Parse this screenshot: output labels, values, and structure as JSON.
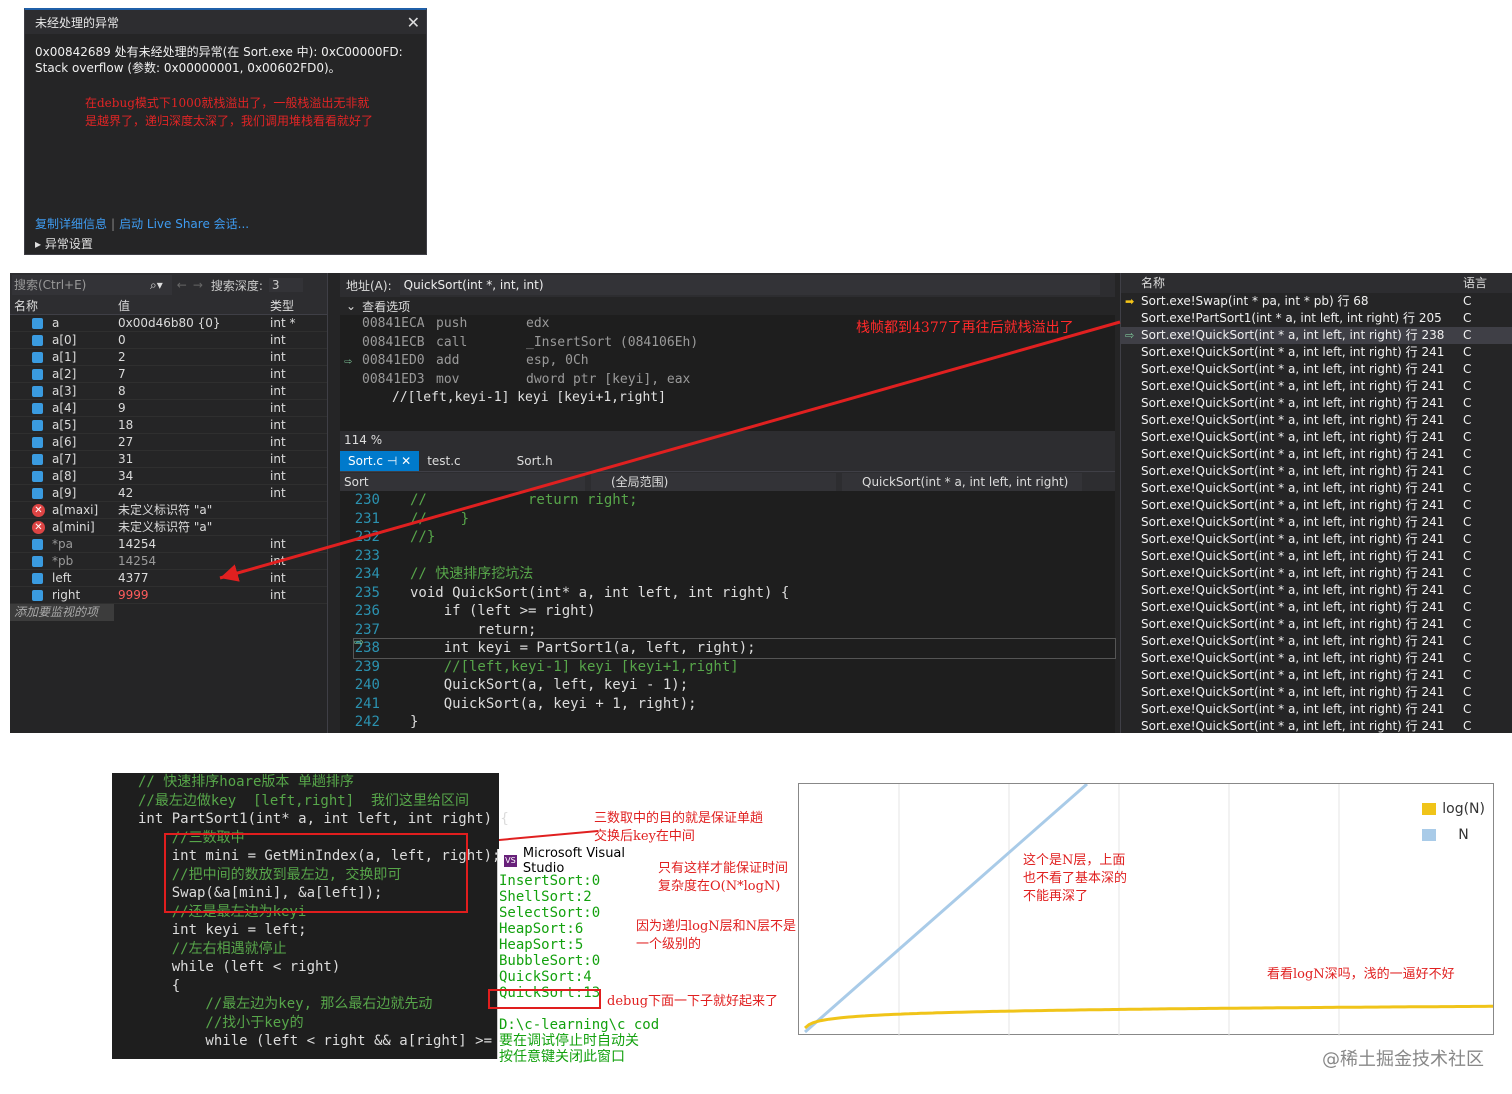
{
  "exception": {
    "title": "未经处理的异常",
    "line1": "0x00842689 处有未经处理的异常(在 Sort.exe 中): 0xC00000FD:",
    "line2": "Stack overflow (参数: 0x00000001, 0x00602FD0)。",
    "note": "在debug模式下1000就栈溢出了，一般栈溢出无非就是越界了，递归深度太深了，我们调用堆栈看看就好了",
    "link1": "复制详细信息",
    "link2": "启动 Live Share 会话...",
    "settings": "异常设置"
  },
  "watch": {
    "search_placeholder": "搜索(Ctrl+E)",
    "depth_label": "搜索深度:",
    "depth_value": "3",
    "col_name": "名称",
    "col_value": "值",
    "col_type": "类型",
    "rows": [
      {
        "name": "a",
        "value": "0x00d46b80 {0}",
        "type": "int *"
      },
      {
        "name": "a[0]",
        "value": "0",
        "type": "int"
      },
      {
        "name": "a[1]",
        "value": "2",
        "type": "int"
      },
      {
        "name": "a[2]",
        "value": "7",
        "type": "int"
      },
      {
        "name": "a[3]",
        "value": "8",
        "type": "int"
      },
      {
        "name": "a[4]",
        "value": "9",
        "type": "int"
      },
      {
        "name": "a[5]",
        "value": "18",
        "type": "int"
      },
      {
        "name": "a[6]",
        "value": "27",
        "type": "int"
      },
      {
        "name": "a[7]",
        "value": "31",
        "type": "int"
      },
      {
        "name": "a[8]",
        "value": "34",
        "type": "int"
      },
      {
        "name": "a[9]",
        "value": "42",
        "type": "int"
      },
      {
        "name": "a[maxi]",
        "value": "未定义标识符 \"a\"",
        "type": ""
      },
      {
        "name": "a[mini]",
        "value": "未定义标识符 \"a\"",
        "type": ""
      },
      {
        "name": "*pa",
        "value": "14254",
        "type": "int"
      },
      {
        "name": "*pb",
        "value": "14254",
        "type": "int"
      },
      {
        "name": "left",
        "value": "4377",
        "type": "int"
      },
      {
        "name": "right",
        "value": "9999",
        "type": "int"
      }
    ],
    "add_watch": "添加要监视的项"
  },
  "disasm": {
    "addr_label": "地址(A):",
    "addr_value": "QuickSort(int *, int, int)",
    "view_options": "查看选项",
    "lines": [
      {
        "addr": "00841ECA",
        "op": "push",
        "arg": "edx"
      },
      {
        "addr": "00841ECB",
        "op": "call",
        "arg": "_InsertSort (084106Eh)"
      },
      {
        "addr": "00841ED0",
        "op": "add",
        "arg": "esp, 0Ch"
      },
      {
        "addr": "00841ED3",
        "op": "mov",
        "arg": "dword ptr [keyi], eax"
      }
    ],
    "comment": "//[left,keyi-1] keyi [keyi+1,right]",
    "zoom": "114 %",
    "annotation": "栈帧都到4377了再往后就栈溢出了"
  },
  "editor": {
    "tab1": "Sort.c",
    "tab2": "test.c",
    "tab3": "Sort.h",
    "nav1": "Sort",
    "nav2": "(全局范围)",
    "nav3": "QuickSort(int * a, int left, int right)",
    "lines": [
      {
        "no": "230",
        "text": "//            return right;"
      },
      {
        "no": "231",
        "text": "//    }"
      },
      {
        "no": "232",
        "text": "//}"
      },
      {
        "no": "233",
        "text": ""
      },
      {
        "no": "234",
        "text": "// 快速排序挖坑法"
      },
      {
        "no": "235",
        "text": "void QuickSort(int* a, int left, int right) {"
      },
      {
        "no": "236",
        "text": "    if (left >= right)"
      },
      {
        "no": "237",
        "text": "        return;"
      },
      {
        "no": "238",
        "text": "    int keyi = PartSort1(a, left, right);"
      },
      {
        "no": "239",
        "text": "    //[left,keyi-1] keyi [keyi+1,right]"
      },
      {
        "no": "240",
        "text": "    QuickSort(a, left, keyi - 1);"
      },
      {
        "no": "241",
        "text": "    QuickSort(a, keyi + 1, right);"
      },
      {
        "no": "242",
        "text": "}"
      }
    ]
  },
  "callstack": {
    "col_name": "名称",
    "col_lang": "语言",
    "rows": [
      {
        "name": "Sort.exe!Swap(int * pa, int * pb) 行 68",
        "lang": "C"
      },
      {
        "name": "Sort.exe!PartSort1(int * a, int left, int right) 行 205",
        "lang": "C"
      },
      {
        "name": "Sort.exe!QuickSort(int * a, int left, int right) 行 238",
        "lang": "C"
      },
      {
        "name": "Sort.exe!QuickSort(int * a, int left, int right) 行 241",
        "lang": "C"
      },
      {
        "name": "Sort.exe!QuickSort(int * a, int left, int right) 行 241",
        "lang": "C"
      },
      {
        "name": "Sort.exe!QuickSort(int * a, int left, int right) 行 241",
        "lang": "C"
      },
      {
        "name": "Sort.exe!QuickSort(int * a, int left, int right) 行 241",
        "lang": "C"
      },
      {
        "name": "Sort.exe!QuickSort(int * a, int left, int right) 行 241",
        "lang": "C"
      },
      {
        "name": "Sort.exe!QuickSort(int * a, int left, int right) 行 241",
        "lang": "C"
      },
      {
        "name": "Sort.exe!QuickSort(int * a, int left, int right) 行 241",
        "lang": "C"
      },
      {
        "name": "Sort.exe!QuickSort(int * a, int left, int right) 行 241",
        "lang": "C"
      },
      {
        "name": "Sort.exe!QuickSort(int * a, int left, int right) 行 241",
        "lang": "C"
      },
      {
        "name": "Sort.exe!QuickSort(int * a, int left, int right) 行 241",
        "lang": "C"
      },
      {
        "name": "Sort.exe!QuickSort(int * a, int left, int right) 行 241",
        "lang": "C"
      },
      {
        "name": "Sort.exe!QuickSort(int * a, int left, int right) 行 241",
        "lang": "C"
      },
      {
        "name": "Sort.exe!QuickSort(int * a, int left, int right) 行 241",
        "lang": "C"
      },
      {
        "name": "Sort.exe!QuickSort(int * a, int left, int right) 行 241",
        "lang": "C"
      },
      {
        "name": "Sort.exe!QuickSort(int * a, int left, int right) 行 241",
        "lang": "C"
      },
      {
        "name": "Sort.exe!QuickSort(int * a, int left, int right) 行 241",
        "lang": "C"
      },
      {
        "name": "Sort.exe!QuickSort(int * a, int left, int right) 行 241",
        "lang": "C"
      },
      {
        "name": "Sort.exe!QuickSort(int * a, int left, int right) 行 241",
        "lang": "C"
      },
      {
        "name": "Sort.exe!QuickSort(int * a, int left, int right) 行 241",
        "lang": "C"
      },
      {
        "name": "Sort.exe!QuickSort(int * a, int left, int right) 行 241",
        "lang": "C"
      },
      {
        "name": "Sort.exe!QuickSort(int * a, int left, int right) 行 241",
        "lang": "C"
      },
      {
        "name": "Sort.exe!QuickSort(int * a, int left, int right) 行 241",
        "lang": "C"
      },
      {
        "name": "Sort.exe!QuickSort(int * a, int left, int right) 行 241",
        "lang": "C"
      }
    ]
  },
  "bottom_code": {
    "lines": [
      {
        "text": "// 快速排序hoare版本 单趟排序",
        "cls": "cm"
      },
      {
        "text": "//最左边做key  [left,right]  我们这里给区间",
        "cls": "cm"
      },
      {
        "text": "int PartSort1(int* a, int left, int right) {",
        "cls": "tx"
      },
      {
        "text": "    //三数取中",
        "cls": "cm"
      },
      {
        "text": "    int mini = GetMinIndex(a, left, right);",
        "cls": "tx"
      },
      {
        "text": "    //把中间的数放到最左边, 交换即可",
        "cls": "cm"
      },
      {
        "text": "    Swap(&a[mini], &a[left]);",
        "cls": "tx"
      },
      {
        "text": "    //还是最左边为keyi",
        "cls": "cm"
      },
      {
        "text": "    int keyi = left;",
        "cls": "tx"
      },
      {
        "text": "    //左右相遇就停止",
        "cls": "cm"
      },
      {
        "text": "    while (left < right)",
        "cls": "tx"
      },
      {
        "text": "    {",
        "cls": "tx"
      },
      {
        "text": "        //最左边为key, 那么最右边就先动",
        "cls": "cm"
      },
      {
        "text": "        //找小于key的",
        "cls": "cm"
      },
      {
        "text": "        while (left < right && a[right] >= a[key",
        "cls": "tx"
      }
    ]
  },
  "console": {
    "title": "Microsoft Visual Studio",
    "lines": [
      "InsertSort:0",
      "ShellSort:2",
      "SelectSort:0",
      "HeapSort:6",
      "HeapSort:5",
      "BubbleSort:0",
      "QuickSort:4",
      "QuickSort:13",
      "",
      "D:\\c-learning\\c code",
      "要在调试停止时自动关",
      "按任意键关闭此窗口"
    ]
  },
  "notes": {
    "n1": "三数取中的目的就是保证单趟交换后key在中间",
    "n2": "只有这样才能保证时间复杂度在O(N*logN)",
    "n3": "因为递归logN层和N层不是一个级别的",
    "n4": "debug下面一下子就好起来了"
  },
  "chart_data": {
    "type": "line",
    "series": [
      {
        "name": "log(N)",
        "color": "#f0c419"
      },
      {
        "name": "N",
        "color": "#a9cbe8"
      }
    ],
    "annotation1": "这个是N层，上面也不看了基本深的不能再深了",
    "annotation2": "看看logN深吗，浅的一逼好不好"
  },
  "watermark": "@稀土掘金技术社区"
}
